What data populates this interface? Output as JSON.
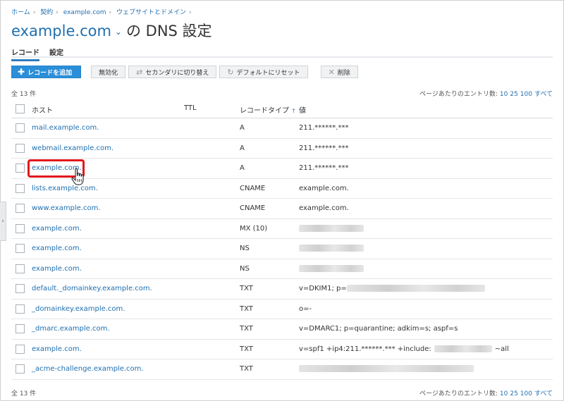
{
  "breadcrumb": [
    "ホーム",
    "契約",
    "example.com",
    "ウェブサイトとドメイン"
  ],
  "title": {
    "domain": "example.com",
    "rest": "の DNS 設定"
  },
  "tabs": [
    "レコード",
    "設定"
  ],
  "toolbar": {
    "add": "レコードを追加",
    "disable": "無効化",
    "secondary": "セカンダリに切り替え",
    "reset": "デフォルトにリセット",
    "delete": "削除"
  },
  "count": "全 13 件",
  "perpage": {
    "label": "ページあたりのエントリ数:",
    "options": [
      "10",
      "25",
      "100",
      "すべて"
    ]
  },
  "columns": {
    "host": "ホスト",
    "ttl": "TTL",
    "type": "レコードタイプ",
    "sort_icon": "↑",
    "value": "値"
  },
  "records": [
    {
      "host": "mail.example.com.",
      "type": "A",
      "value": "211.******.***"
    },
    {
      "host": "webmail.example.com.",
      "type": "A",
      "value": "211.******.***"
    },
    {
      "host": "example.com.",
      "type": "A",
      "value": "211.******.***"
    },
    {
      "host": "lists.example.com.",
      "type": "CNAME",
      "value": "example.com."
    },
    {
      "host": "www.example.com.",
      "type": "CNAME",
      "value": "example.com."
    },
    {
      "host": "example.com.",
      "type": "MX (10)",
      "value": ""
    },
    {
      "host": "example.com.",
      "type": "NS",
      "value": ""
    },
    {
      "host": "example.com.",
      "type": "NS",
      "value": ""
    },
    {
      "host": "default._domainkey.example.com.",
      "type": "TXT",
      "value": "v=DKIM1; p="
    },
    {
      "host": "_domainkey.example.com.",
      "type": "TXT",
      "value": "o=-"
    },
    {
      "host": "_dmarc.example.com.",
      "type": "TXT",
      "value": "v=DMARC1; p=quarantine; adkim=s; aspf=s"
    },
    {
      "host": "example.com.",
      "type": "TXT",
      "value": "v=spf1 +ip4:211.******.*** +include:",
      "value_suffix": "~all"
    },
    {
      "host": "_acme-challenge.example.com.",
      "type": "TXT",
      "value": ""
    }
  ],
  "colors": {
    "accent": "#1f6fb0",
    "primary_button": "#2b8ed8",
    "highlight": "#e3161b"
  },
  "icons": {
    "add": "plus-icon",
    "secondary": "switch-icon",
    "reset": "reset-icon",
    "delete": "x-icon",
    "sidebar": "chevron-right-icon"
  }
}
